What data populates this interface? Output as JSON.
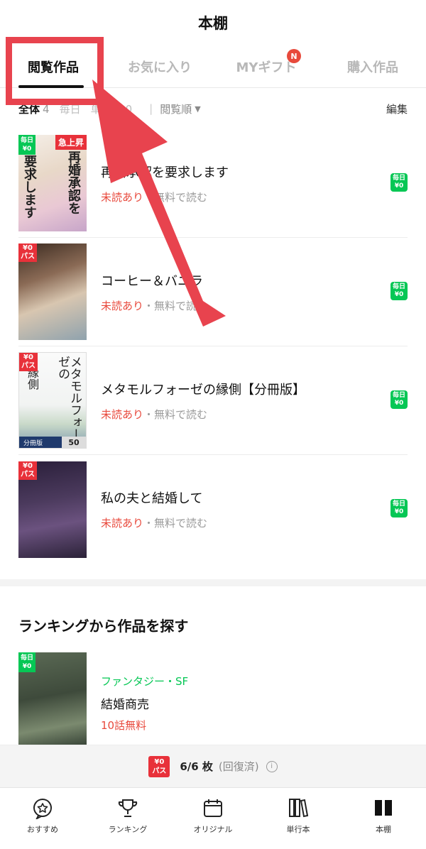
{
  "header": {
    "title": "本棚"
  },
  "tabs": [
    {
      "label": "閲覧作品",
      "active": true
    },
    {
      "label": "お気に入り",
      "active": false
    },
    {
      "label": "MYギフト",
      "active": false,
      "badge": "N"
    },
    {
      "label": "購入作品",
      "active": false
    }
  ],
  "filters": {
    "all_label": "全体",
    "all_count": "4",
    "daily_label": "毎日",
    "daily_count": "",
    "volume_label": "単行本",
    "volume_count": "0",
    "separator": "|",
    "sort_label": "閲覧順",
    "sort_arrow": "▼",
    "edit_label": "編集"
  },
  "items": [
    {
      "title": "再婚承認を要求します",
      "unread": "未読あり",
      "dot": "・",
      "read_free": "無料で読む",
      "cover_text": "再婚承認を",
      "cover_text2": "要求します",
      "cover_tag": "daily",
      "rise_tag": "急上昇",
      "right_badge_top": "毎日",
      "right_badge_bottom": "¥0"
    },
    {
      "title": "コーヒー＆バニラ",
      "unread": "未読あり",
      "dot": "・",
      "read_free": "無料で読む",
      "cover_tag": "pass",
      "right_badge_top": "毎日",
      "right_badge_bottom": "¥0"
    },
    {
      "title": "メタモルフォーゼの縁側【分冊版】",
      "unread": "未読あり",
      "dot": "・",
      "read_free": "無料で読む",
      "cover_text": "メタモルフォーゼの",
      "cover_text2": "縁側",
      "cover_tag": "pass",
      "vol_label": "分冊版",
      "vol_num": "50",
      "right_badge_top": "毎日",
      "right_badge_bottom": "¥0"
    },
    {
      "title": "私の夫と結婚して",
      "unread": "未読あり",
      "dot": "・",
      "read_free": "無料で読む",
      "cover_tag": "pass",
      "right_badge_top": "毎日",
      "right_badge_bottom": "¥0"
    }
  ],
  "tag_daily": {
    "top": "毎日",
    "bottom": "¥0"
  },
  "tag_pass": {
    "top": "¥0",
    "bottom": "パス"
  },
  "ranking": {
    "section_title": "ランキングから作品を探す",
    "genre": "ファンタジー・SF",
    "title": "結婚商売",
    "free_eps": "10話無料"
  },
  "pass_bar": {
    "logo_top": "¥0",
    "logo_bottom": "パス",
    "count": "6/6 枚",
    "status": "(回復済)",
    "info": "i"
  },
  "nav": [
    {
      "label": "おすすめ",
      "icon": "recommend-icon"
    },
    {
      "label": "ランキング",
      "icon": "trophy-icon"
    },
    {
      "label": "オリジナル",
      "icon": "calendar-icon"
    },
    {
      "label": "単行本",
      "icon": "books-icon"
    },
    {
      "label": "本棚",
      "icon": "bookshelf-icon"
    }
  ],
  "colors": {
    "accent_green": "#06c755",
    "accent_red": "#e8313a",
    "annotation_red": "#e8434e"
  }
}
